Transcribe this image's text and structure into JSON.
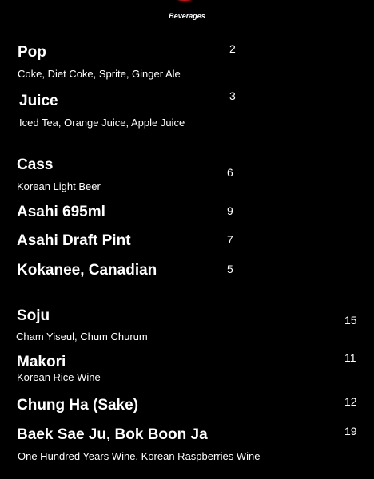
{
  "header": {
    "section": "Beverages"
  },
  "items": [
    {
      "name": "Pop",
      "desc": "Coke, Diet Coke, Sprite, Ginger Ale",
      "price": "2"
    },
    {
      "name": "Juice",
      "desc": "Iced Tea, Orange Juice, Apple Juice",
      "price": "3"
    },
    {
      "name": "Cass",
      "desc": "Korean Light Beer",
      "price": "6"
    },
    {
      "name": "Asahi 695ml",
      "desc": "",
      "price": "9"
    },
    {
      "name": "Asahi Draft Pint",
      "desc": "",
      "price": "7"
    },
    {
      "name": "Kokanee, Canadian",
      "desc": "",
      "price": "5"
    },
    {
      "name": "Soju",
      "desc": "Cham Yiseul, Chum Churum",
      "price": "15"
    },
    {
      "name": "Makori",
      "desc": "Korean Rice Wine",
      "price": "11"
    },
    {
      "name": "Chung Ha (Sake)",
      "desc": "",
      "price": "12"
    },
    {
      "name": "Baek Sae Ju, Bok Boon Ja",
      "desc": "One Hundred Years Wine, Korean Raspberries Wine",
      "price": "19"
    }
  ],
  "colors": {
    "background": "#000000",
    "text": "#ffffff",
    "logo": "#c4161c"
  }
}
